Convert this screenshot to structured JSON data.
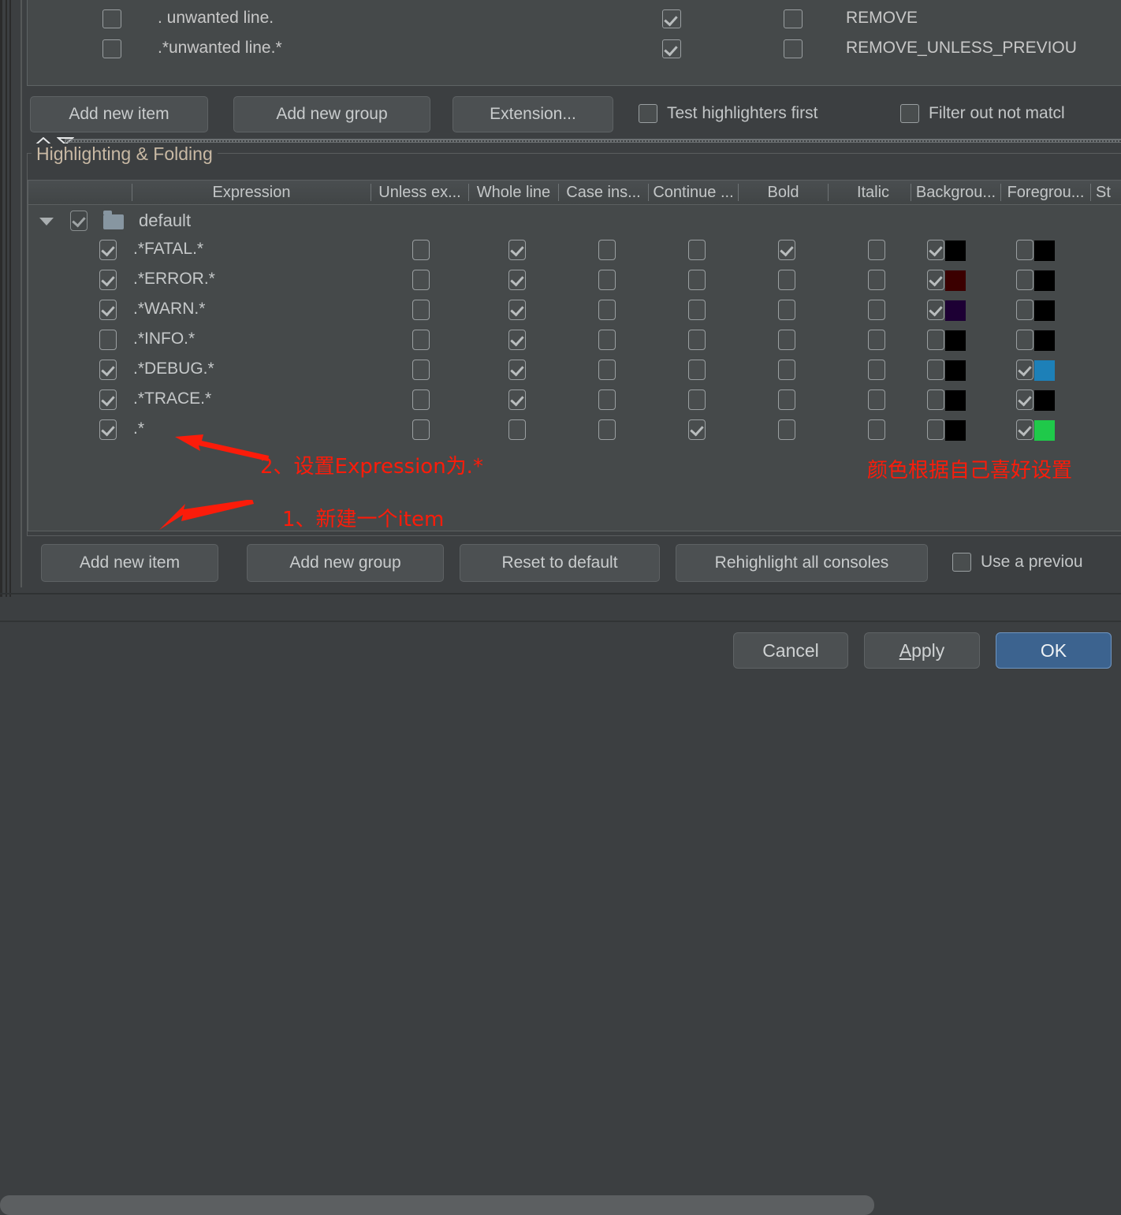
{
  "theme": {
    "window_bg": "#3c3f41",
    "panel_bg": "#45494a",
    "border": "#5c6061",
    "text": "#c5c8c9",
    "group_title": "#c9b9a4",
    "annotation_red": "#fb1c0a",
    "ok_button_bg": "#3c638f"
  },
  "top_list": {
    "rows": [
      {
        "checked": false,
        "expression": ". unwanted line.",
        "folding_checked": true,
        "second_checked": false,
        "action": "REMOVE"
      },
      {
        "checked": false,
        "expression": ".*unwanted line.*",
        "folding_checked": true,
        "second_checked": false,
        "action": "REMOVE_UNLESS_PREVIOU"
      }
    ]
  },
  "top_toolbar": {
    "buttons": [
      {
        "label": "Add new item"
      },
      {
        "label": "Add new group"
      },
      {
        "label": "Extension..."
      }
    ],
    "checkboxes": [
      {
        "label": "Test highlighters first",
        "checked": false
      },
      {
        "label": "Filter out not matcl",
        "checked": false
      }
    ]
  },
  "highlighting": {
    "group_title": "Highlighting & Folding",
    "columns": [
      {
        "label": ""
      },
      {
        "label": "Expression"
      },
      {
        "label": "Unless ex..."
      },
      {
        "label": "Whole line"
      },
      {
        "label": "Case ins..."
      },
      {
        "label": "Continue ..."
      },
      {
        "label": "Bold"
      },
      {
        "label": "Italic"
      },
      {
        "label": "Backgrou..."
      },
      {
        "label": "Foregrou..."
      },
      {
        "label": "St"
      }
    ],
    "group_row": {
      "expanded": true,
      "checked": true,
      "name": "default",
      "icon": "folder-icon"
    },
    "rows": [
      {
        "enabled": true,
        "expression": ".*FATAL.*",
        "unless_expression": false,
        "whole_line": true,
        "case_insensitive": false,
        "continue_matching": false,
        "bold": true,
        "italic": false,
        "background_enabled": true,
        "background_color": "#000000",
        "foreground_enabled": false,
        "foreground_color": "#000000"
      },
      {
        "enabled": true,
        "expression": ".*ERROR.*",
        "unless_expression": false,
        "whole_line": true,
        "case_insensitive": false,
        "continue_matching": false,
        "bold": false,
        "italic": false,
        "background_enabled": true,
        "background_color": "#3b0000",
        "foreground_enabled": false,
        "foreground_color": "#000000"
      },
      {
        "enabled": true,
        "expression": ".*WARN.*",
        "unless_expression": false,
        "whole_line": true,
        "case_insensitive": false,
        "continue_matching": false,
        "bold": false,
        "italic": false,
        "background_enabled": true,
        "background_color": "#1d0034",
        "foreground_enabled": false,
        "foreground_color": "#000000"
      },
      {
        "enabled": false,
        "expression": ".*INFO.*",
        "unless_expression": false,
        "whole_line": true,
        "case_insensitive": false,
        "continue_matching": false,
        "bold": false,
        "italic": false,
        "background_enabled": false,
        "background_color": "#000000",
        "foreground_enabled": false,
        "foreground_color": "#000000"
      },
      {
        "enabled": true,
        "expression": ".*DEBUG.*",
        "unless_expression": false,
        "whole_line": true,
        "case_insensitive": false,
        "continue_matching": false,
        "bold": false,
        "italic": false,
        "background_enabled": false,
        "background_color": "#000000",
        "foreground_enabled": true,
        "foreground_color": "#1d80b8"
      },
      {
        "enabled": true,
        "expression": ".*TRACE.*",
        "unless_expression": false,
        "whole_line": true,
        "case_insensitive": false,
        "continue_matching": false,
        "bold": false,
        "italic": false,
        "background_enabled": false,
        "background_color": "#000000",
        "foreground_enabled": true,
        "foreground_color": "#000000"
      },
      {
        "enabled": true,
        "expression": ".*",
        "unless_expression": false,
        "whole_line": false,
        "case_insensitive": false,
        "continue_matching": true,
        "bold": false,
        "italic": false,
        "background_enabled": false,
        "background_color": "#000000",
        "foreground_enabled": true,
        "foreground_color": "#1fc94a"
      }
    ],
    "toolbar": {
      "buttons": [
        {
          "label": "Add new item"
        },
        {
          "label": "Add new group"
        },
        {
          "label": "Reset to default"
        },
        {
          "label": "Rehighlight all consoles"
        }
      ],
      "checkbox": {
        "label": "Use a previou",
        "checked": false
      }
    }
  },
  "annotations": [
    {
      "id": "anno-expression",
      "text": "2、设置Expression为.*"
    },
    {
      "id": "anno-new-item",
      "text": "1、新建一个item"
    },
    {
      "id": "anno-colors",
      "text": "颜色根据自己喜好设置"
    }
  ],
  "footer": {
    "cancel": "Cancel",
    "apply_prefix": "A",
    "apply_suffix": "pply",
    "ok": "OK"
  }
}
